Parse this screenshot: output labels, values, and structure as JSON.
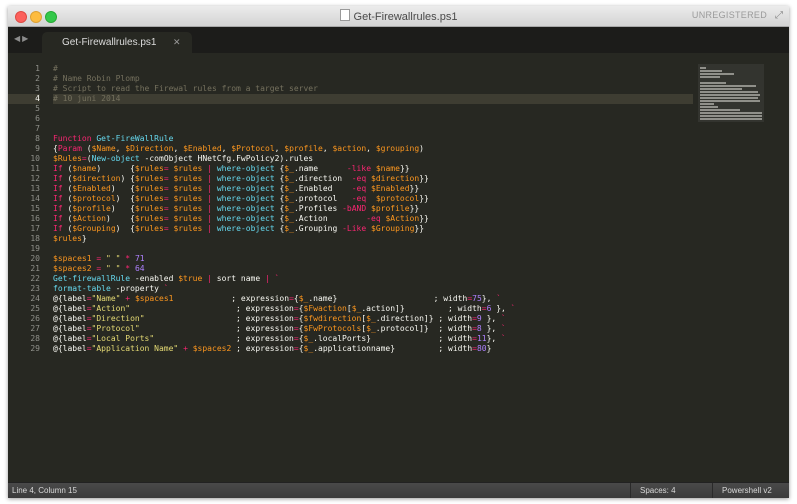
{
  "window": {
    "title": "Get-Firewallrules.ps1",
    "registration": "UNREGISTERED"
  },
  "tabs": [
    {
      "label": "Get-Firewallrules.ps1",
      "active": true
    }
  ],
  "editor": {
    "current_line": 4,
    "line_numbers": [
      "1",
      "2",
      "3",
      "4",
      "5",
      "6",
      "7",
      "8",
      "9",
      "10",
      "11",
      "12",
      "13",
      "14",
      "15",
      "16",
      "17",
      "18",
      "19",
      "20",
      "21",
      "22",
      "23",
      "24",
      "25",
      "26",
      "27",
      "28",
      "29"
    ]
  },
  "status": {
    "position": "Line 4, Column 15",
    "indentation": "Spaces: 4",
    "syntax": "Powershell v2"
  },
  "colors": {
    "background": "#272822",
    "comment": "#75715e",
    "keyword": "#f92672",
    "variable": "#fd971f",
    "string": "#e6db74",
    "number": "#ae81ff",
    "function": "#66d9ef",
    "text": "#f8f8f2"
  }
}
